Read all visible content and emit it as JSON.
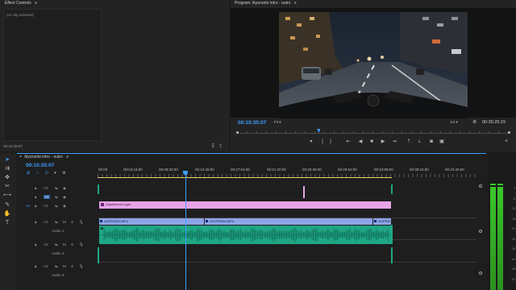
{
  "effect_controls": {
    "title": "Effect Controls",
    "menu_icon": "hamburger-icon",
    "placeholder": "(no clip selected)",
    "timecode": "00:10:35:07"
  },
  "program": {
    "title": "Program: tkyoranto intro - outro",
    "menu_icon": "hamburger-icon",
    "timecode": "00:10:35:07",
    "zoom": "Fit",
    "resolution": "1/4",
    "duration": "00:35:25:15",
    "playhead_fraction": 0.3
  },
  "sequence": {
    "tab_title": "tkyoranto intro - outro",
    "timecode": "00:10:35:07",
    "ruler": [
      "00:00",
      "00:04:16:00",
      "00:08:32:00",
      "00:12:48:00",
      "00:17:04:00",
      "00:21:20:00",
      "00:25:36:00",
      "00:29:52:00",
      "00:34:08:00",
      "00:38:24:00",
      "00:42:40:00"
    ],
    "tracks": {
      "v3": "V3",
      "v2": "V2",
      "v1": "V1",
      "a1": "A1",
      "audio1": "Audio 1",
      "a2": "A2",
      "audio2": "Audio 2",
      "a3": "A3",
      "audio3": "Audio 3"
    },
    "clips": {
      "adjustment": "Adjustment Layer",
      "video1": "GOPR0059.MP4",
      "video2": "GOPR0060.MP4",
      "video3": "GOPR0061.MP4"
    }
  },
  "meter_labels": [
    "0",
    "-6",
    "-12",
    "-18",
    "-24",
    "-30",
    "-36",
    "-42",
    "-48",
    "-54"
  ],
  "colors": {
    "accent": "#3f9fff",
    "adjustment_clip": "#e7a3e7",
    "video_clip": "#8da4e6",
    "audio_clip": "#1fa685",
    "meter": "#39c82a"
  }
}
